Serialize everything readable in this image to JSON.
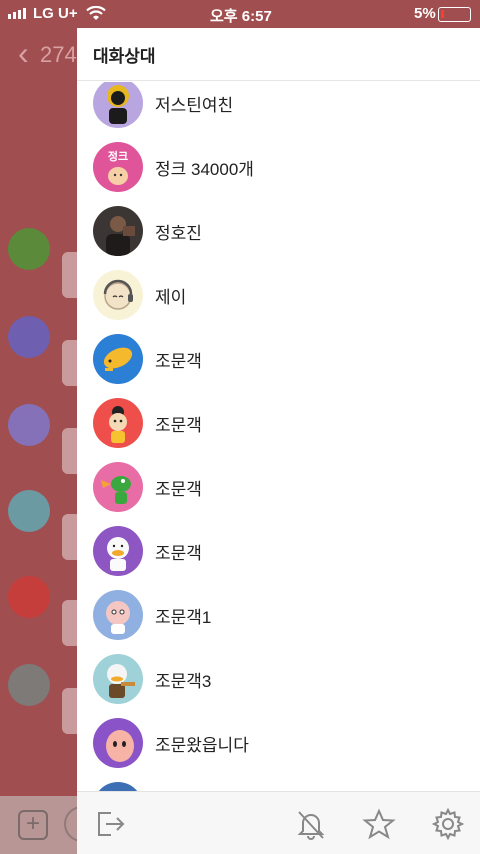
{
  "status": {
    "carrier": "LG U+",
    "time": "오후 6:57",
    "battery": "5%"
  },
  "chat": {
    "back_count": "274"
  },
  "drawer": {
    "title": "대화상대",
    "members": [
      {
        "name": "저스틴여친",
        "avatar_color": "#b9a5e0",
        "avatar_icon": "black-suit-character"
      },
      {
        "name": "정크 34000개",
        "avatar_color": "#e0559a",
        "avatar_icon": "pink-text-character",
        "avatar_text": "정크"
      },
      {
        "name": "정호진",
        "avatar_color": "#3b3634",
        "avatar_icon": "photo-person"
      },
      {
        "name": "제이",
        "avatar_color": "#f8f2d6",
        "avatar_icon": "headset-character"
      },
      {
        "name": "조문객",
        "avatar_color": "#2b7fd4",
        "avatar_icon": "yellow-lying-character"
      },
      {
        "name": "조문객",
        "avatar_color": "#ef4f4b",
        "avatar_icon": "black-hair-character"
      },
      {
        "name": "조문객",
        "avatar_color": "#e86ca5",
        "avatar_icon": "green-crocodile-character"
      },
      {
        "name": "조문객",
        "avatar_color": "#8e56c2",
        "avatar_icon": "white-duck-character"
      },
      {
        "name": "조문객1",
        "avatar_color": "#8fb0e0",
        "avatar_icon": "pink-bald-character"
      },
      {
        "name": "조문객3",
        "avatar_color": "#9fd1d8",
        "avatar_icon": "duck-guitar-character"
      },
      {
        "name": "조문왔읍니다",
        "avatar_color": "#8a53c8",
        "avatar_icon": "peach-character"
      }
    ]
  },
  "footer": {
    "icons": [
      "exit-icon",
      "bell-off-icon",
      "star-icon",
      "settings-icon"
    ]
  }
}
